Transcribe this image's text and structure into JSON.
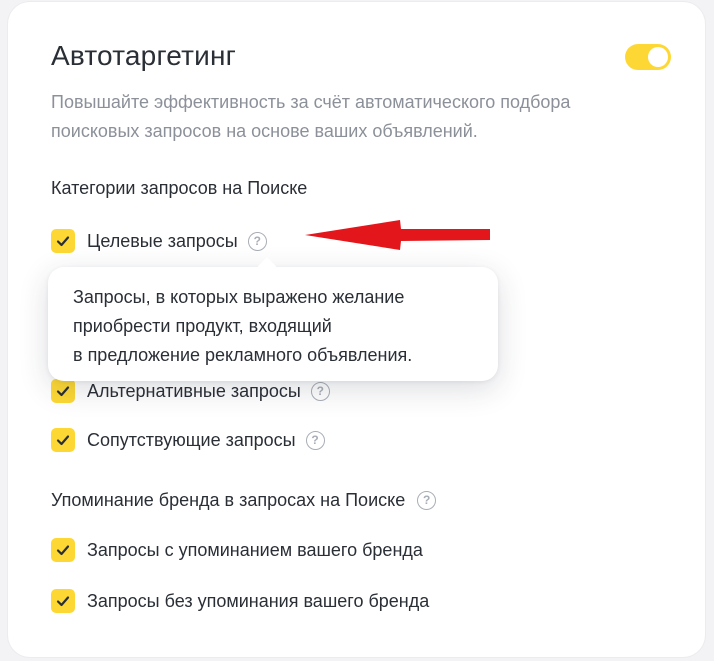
{
  "accent_color": "#fdd835",
  "card": {
    "title": "Автотаргетинг",
    "toggle_on": true,
    "description": "Повышайте эффективность за счёт автоматического подбора поисковых запросов на основе ваших объявлений."
  },
  "categories": {
    "title": "Категории запросов на Поиске",
    "items": [
      {
        "label": "Целевые запросы",
        "checked": true,
        "help_icon": "question-circle-icon"
      },
      {
        "label": "Альтернативные запросы",
        "checked": true,
        "help_icon": "question-circle-icon"
      },
      {
        "label": "Сопутствующие запросы",
        "checked": true,
        "help_icon": "question-circle-icon"
      }
    ]
  },
  "tooltip": {
    "lines": [
      "Запросы, в которых выражено желание",
      "приобрести продукт, входящий",
      "в предложение рекламного объявления."
    ]
  },
  "brand": {
    "title": "Упоминание бренда в запросах на Поиске",
    "items": [
      {
        "label": "Запросы с упоминанием вашего бренда",
        "checked": true
      },
      {
        "label": "Запросы без упоминания вашего бренда",
        "checked": true
      }
    ]
  },
  "annotation": {
    "arrow_color": "#e3171b"
  }
}
